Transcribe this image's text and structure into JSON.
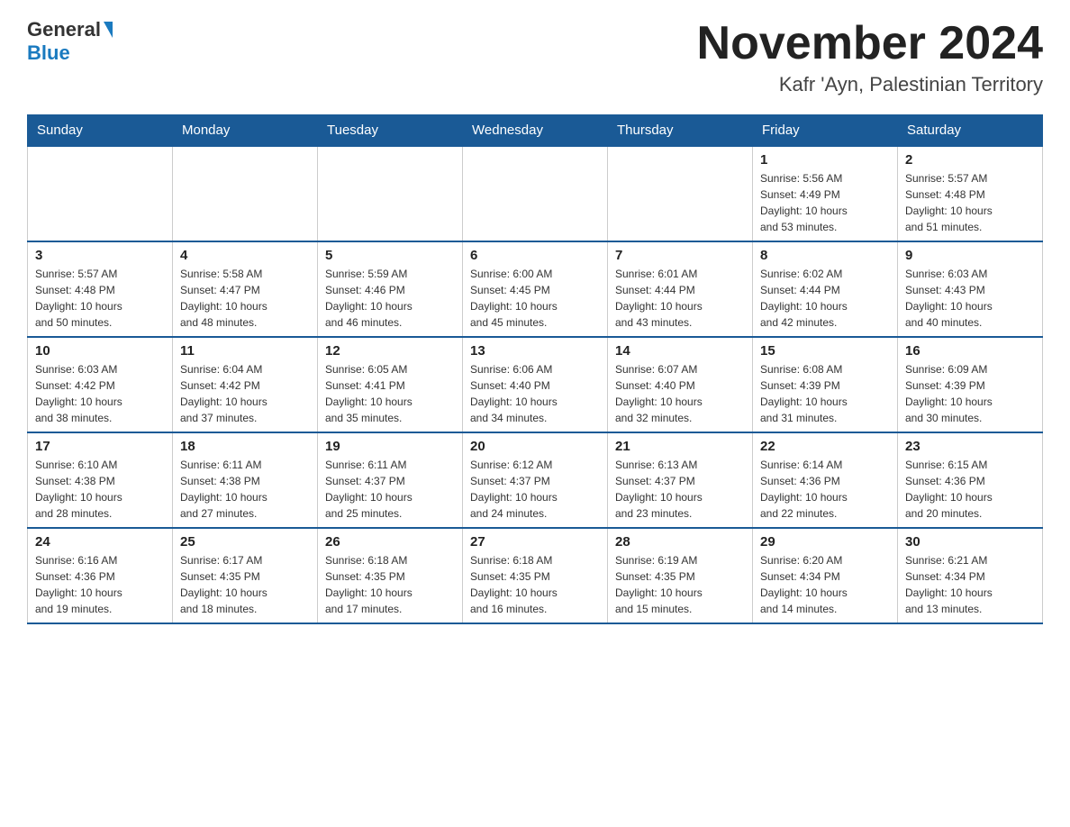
{
  "header": {
    "logo": {
      "line1": "General",
      "line2": "Blue"
    },
    "title": "November 2024",
    "location": "Kafr 'Ayn, Palestinian Territory"
  },
  "days_of_week": [
    "Sunday",
    "Monday",
    "Tuesday",
    "Wednesday",
    "Thursday",
    "Friday",
    "Saturday"
  ],
  "weeks": [
    {
      "days": [
        {
          "number": "",
          "info": ""
        },
        {
          "number": "",
          "info": ""
        },
        {
          "number": "",
          "info": ""
        },
        {
          "number": "",
          "info": ""
        },
        {
          "number": "",
          "info": ""
        },
        {
          "number": "1",
          "info": "Sunrise: 5:56 AM\nSunset: 4:49 PM\nDaylight: 10 hours\nand 53 minutes."
        },
        {
          "number": "2",
          "info": "Sunrise: 5:57 AM\nSunset: 4:48 PM\nDaylight: 10 hours\nand 51 minutes."
        }
      ]
    },
    {
      "days": [
        {
          "number": "3",
          "info": "Sunrise: 5:57 AM\nSunset: 4:48 PM\nDaylight: 10 hours\nand 50 minutes."
        },
        {
          "number": "4",
          "info": "Sunrise: 5:58 AM\nSunset: 4:47 PM\nDaylight: 10 hours\nand 48 minutes."
        },
        {
          "number": "5",
          "info": "Sunrise: 5:59 AM\nSunset: 4:46 PM\nDaylight: 10 hours\nand 46 minutes."
        },
        {
          "number": "6",
          "info": "Sunrise: 6:00 AM\nSunset: 4:45 PM\nDaylight: 10 hours\nand 45 minutes."
        },
        {
          "number": "7",
          "info": "Sunrise: 6:01 AM\nSunset: 4:44 PM\nDaylight: 10 hours\nand 43 minutes."
        },
        {
          "number": "8",
          "info": "Sunrise: 6:02 AM\nSunset: 4:44 PM\nDaylight: 10 hours\nand 42 minutes."
        },
        {
          "number": "9",
          "info": "Sunrise: 6:03 AM\nSunset: 4:43 PM\nDaylight: 10 hours\nand 40 minutes."
        }
      ]
    },
    {
      "days": [
        {
          "number": "10",
          "info": "Sunrise: 6:03 AM\nSunset: 4:42 PM\nDaylight: 10 hours\nand 38 minutes."
        },
        {
          "number": "11",
          "info": "Sunrise: 6:04 AM\nSunset: 4:42 PM\nDaylight: 10 hours\nand 37 minutes."
        },
        {
          "number": "12",
          "info": "Sunrise: 6:05 AM\nSunset: 4:41 PM\nDaylight: 10 hours\nand 35 minutes."
        },
        {
          "number": "13",
          "info": "Sunrise: 6:06 AM\nSunset: 4:40 PM\nDaylight: 10 hours\nand 34 minutes."
        },
        {
          "number": "14",
          "info": "Sunrise: 6:07 AM\nSunset: 4:40 PM\nDaylight: 10 hours\nand 32 minutes."
        },
        {
          "number": "15",
          "info": "Sunrise: 6:08 AM\nSunset: 4:39 PM\nDaylight: 10 hours\nand 31 minutes."
        },
        {
          "number": "16",
          "info": "Sunrise: 6:09 AM\nSunset: 4:39 PM\nDaylight: 10 hours\nand 30 minutes."
        }
      ]
    },
    {
      "days": [
        {
          "number": "17",
          "info": "Sunrise: 6:10 AM\nSunset: 4:38 PM\nDaylight: 10 hours\nand 28 minutes."
        },
        {
          "number": "18",
          "info": "Sunrise: 6:11 AM\nSunset: 4:38 PM\nDaylight: 10 hours\nand 27 minutes."
        },
        {
          "number": "19",
          "info": "Sunrise: 6:11 AM\nSunset: 4:37 PM\nDaylight: 10 hours\nand 25 minutes."
        },
        {
          "number": "20",
          "info": "Sunrise: 6:12 AM\nSunset: 4:37 PM\nDaylight: 10 hours\nand 24 minutes."
        },
        {
          "number": "21",
          "info": "Sunrise: 6:13 AM\nSunset: 4:37 PM\nDaylight: 10 hours\nand 23 minutes."
        },
        {
          "number": "22",
          "info": "Sunrise: 6:14 AM\nSunset: 4:36 PM\nDaylight: 10 hours\nand 22 minutes."
        },
        {
          "number": "23",
          "info": "Sunrise: 6:15 AM\nSunset: 4:36 PM\nDaylight: 10 hours\nand 20 minutes."
        }
      ]
    },
    {
      "days": [
        {
          "number": "24",
          "info": "Sunrise: 6:16 AM\nSunset: 4:36 PM\nDaylight: 10 hours\nand 19 minutes."
        },
        {
          "number": "25",
          "info": "Sunrise: 6:17 AM\nSunset: 4:35 PM\nDaylight: 10 hours\nand 18 minutes."
        },
        {
          "number": "26",
          "info": "Sunrise: 6:18 AM\nSunset: 4:35 PM\nDaylight: 10 hours\nand 17 minutes."
        },
        {
          "number": "27",
          "info": "Sunrise: 6:18 AM\nSunset: 4:35 PM\nDaylight: 10 hours\nand 16 minutes."
        },
        {
          "number": "28",
          "info": "Sunrise: 6:19 AM\nSunset: 4:35 PM\nDaylight: 10 hours\nand 15 minutes."
        },
        {
          "number": "29",
          "info": "Sunrise: 6:20 AM\nSunset: 4:34 PM\nDaylight: 10 hours\nand 14 minutes."
        },
        {
          "number": "30",
          "info": "Sunrise: 6:21 AM\nSunset: 4:34 PM\nDaylight: 10 hours\nand 13 minutes."
        }
      ]
    }
  ]
}
